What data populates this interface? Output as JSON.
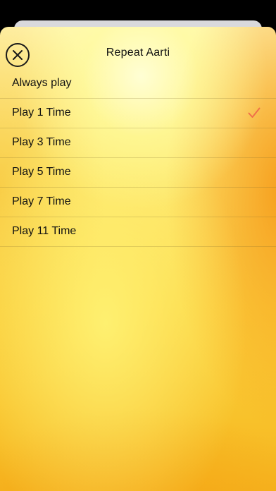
{
  "sheet": {
    "title": "Repeat Aarti"
  },
  "header": {
    "close_icon": "close-x-circle-icon"
  },
  "options": [
    {
      "label": "Always play",
      "selected": false
    },
    {
      "label": "Play 1 Time",
      "selected": true
    },
    {
      "label": "Play 3 Time",
      "selected": false
    },
    {
      "label": "Play 5 Time",
      "selected": false
    },
    {
      "label": "Play 7 Time",
      "selected": false
    },
    {
      "label": "Play 11 Time",
      "selected": false
    }
  ],
  "colors": {
    "checkmark": "#f0704a",
    "text": "#111111",
    "background_top": "#fff5b2",
    "background_bottom": "#f5b21e"
  }
}
